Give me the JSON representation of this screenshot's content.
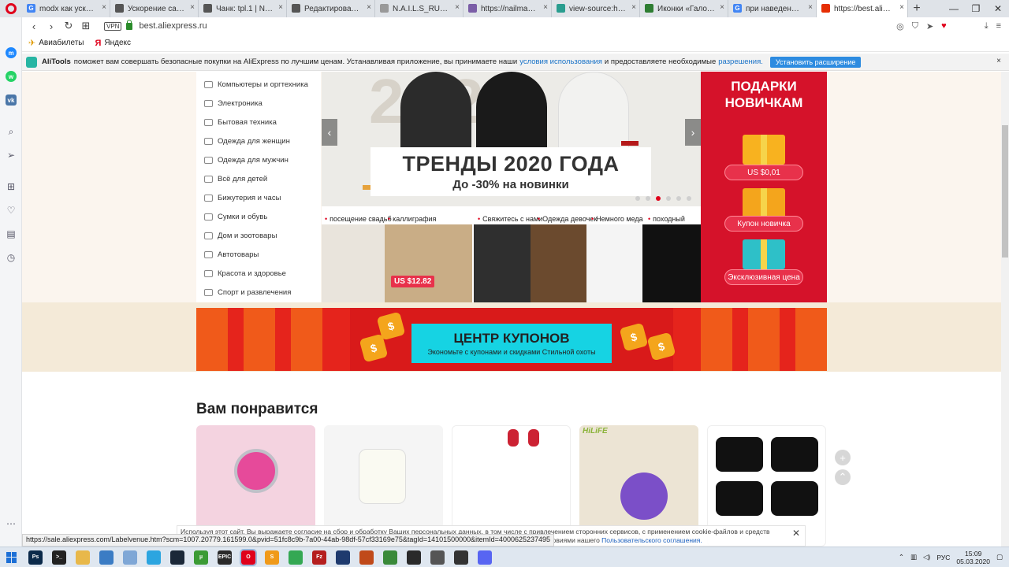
{
  "browser": {
    "tabs": [
      {
        "label": "modx как ускорить с",
        "favicon": "G",
        "color": "#4285f4"
      },
      {
        "label": "Ускорение сайта на",
        "favicon": "",
        "color": "#555555"
      },
      {
        "label": "Чанк: tpl.1 | N.A.I.L.S",
        "favicon": "",
        "color": "#555555"
      },
      {
        "label": "Редактировать файл",
        "favicon": "",
        "color": "#555555"
      },
      {
        "label": "N.A.I.L.S_RUSSIA",
        "favicon": "",
        "color": "#999999"
      },
      {
        "label": "https://nailmagazine",
        "favicon": "",
        "color": "#7b5ea7"
      },
      {
        "label": "view-source:https://n",
        "favicon": "",
        "color": "#2a9d8f"
      },
      {
        "label": "Иконки «Галочка ф",
        "favicon": "",
        "color": "#2e7d32"
      },
      {
        "label": "при наведение на с",
        "favicon": "G",
        "color": "#4285f4"
      },
      {
        "label": "https://best.aliexpre",
        "favicon": "",
        "color": "#e62e04"
      }
    ],
    "new_tab": "+",
    "window_controls": {
      "minimize": "—",
      "maximize": "❐",
      "close": "✕"
    },
    "nav": {
      "back": "‹",
      "forward": "›",
      "reload": "↻",
      "speed_dial": "⊞"
    },
    "vpn": "VPN",
    "url": "best.aliexpress.ru",
    "bookmarks": [
      {
        "label": "Авиабилеты",
        "icon": "plane-icon"
      },
      {
        "label": "Яндекс",
        "icon": "yandex-icon"
      }
    ]
  },
  "alitools": {
    "brand": "AliTools",
    "text_before": "поможет вам совершать безопасные покупки на AliExpress по лучшим ценам. Устанавливая приложение, вы принимаете наши",
    "terms_link": "условия использования",
    "text_middle": "и предоставляете необходимые",
    "permissions_link": "разрешения.",
    "install_button": "Установить расширение",
    "close": "×"
  },
  "categories": [
    "Компьютеры и оргтехника",
    "Электроника",
    "Бытовая техника",
    "Одежда для женщин",
    "Одежда для мужчин",
    "Всё для детей",
    "Бижутерия и часы",
    "Сумки и обувь",
    "Дом и зоотовары",
    "Автотовары",
    "Красота и здоровье",
    "Спорт и развлечения"
  ],
  "slider": {
    "title": "ТРЕНДЫ 2020 ГОДА",
    "subtitle": "До -30% на новинки",
    "prev": "‹",
    "next": "›",
    "dots": 6,
    "active_dot": 2
  },
  "gifts": {
    "title_line1": "ПОДАРКИ",
    "title_line2": "НОВИЧКАМ",
    "price": "US $0,01",
    "coupon": "Купон новичка",
    "exclusive": "Эксклюзивная цена"
  },
  "thumbs": {
    "labels": [
      "посещение свадьб",
      "каллиграфия",
      "Свяжитесь с нами",
      "Одежда девочек",
      "Немного меда",
      "походный"
    ],
    "price_tag": "US $12.82"
  },
  "coupon_center": {
    "title": "ЦЕНТР КУПОНОВ",
    "subtitle": "Экономьте с купонами и скидками Стильной охоты"
  },
  "recommend": {
    "title": "Вам понравится",
    "brand_badge": "HiLiFE"
  },
  "cookie": {
    "line1": "Используя этот сайт, Вы выражаете согласие на сбор и обработку Ваших персональных данных, в том числе с привлечением сторонних сервисов, с применением cookie-файлов и средств",
    "line2": "в соответствии с условиями нашего",
    "link": "Пользовательского соглашения.",
    "close": "✕"
  },
  "status_url": "https://sale.aliexpress.com/Labelvenue.htm?scm=1007.20779.161599.0&pvid=51fc8c9b-7a00-44ab-98df-57cf33169e75&tagId=14101500000&itemId=4000625237495",
  "taskbar": {
    "apps": [
      {
        "label": "Ps",
        "color": "#0b2a4a"
      },
      {
        "label": ">_",
        "color": "#222222"
      },
      {
        "label": "",
        "color": "#e8b84a"
      },
      {
        "label": "",
        "color": "#3b7cc4"
      },
      {
        "label": "",
        "color": "#7fa7d6"
      },
      {
        "label": "",
        "color": "#2ca5e0"
      },
      {
        "label": "",
        "color": "#1b2838"
      },
      {
        "label": "µ",
        "color": "#3b9b35"
      },
      {
        "label": "EPIC",
        "color": "#2a2a2a"
      },
      {
        "label": "O",
        "color": "#e0001b"
      },
      {
        "label": "S",
        "color": "#f09a1a"
      },
      {
        "label": "",
        "color": "#34a853"
      },
      {
        "label": "Fz",
        "color": "#b51f1f"
      },
      {
        "label": "",
        "color": "#1e3a6e"
      },
      {
        "label": "",
        "color": "#c04a1a"
      },
      {
        "label": "",
        "color": "#3a8a3a"
      },
      {
        "label": "",
        "color": "#2a2a2a"
      },
      {
        "label": "",
        "color": "#555555"
      },
      {
        "label": "",
        "color": "#333333"
      },
      {
        "label": "",
        "color": "#5865f2"
      }
    ],
    "lang": "РУС",
    "time": "15:09",
    "date": "05.03.2020"
  },
  "colors": {
    "accent": "#e0001b",
    "ali_red": "#d5122a",
    "coupon_cyan": "#16d3e3",
    "link_blue": "#1a73c8"
  }
}
